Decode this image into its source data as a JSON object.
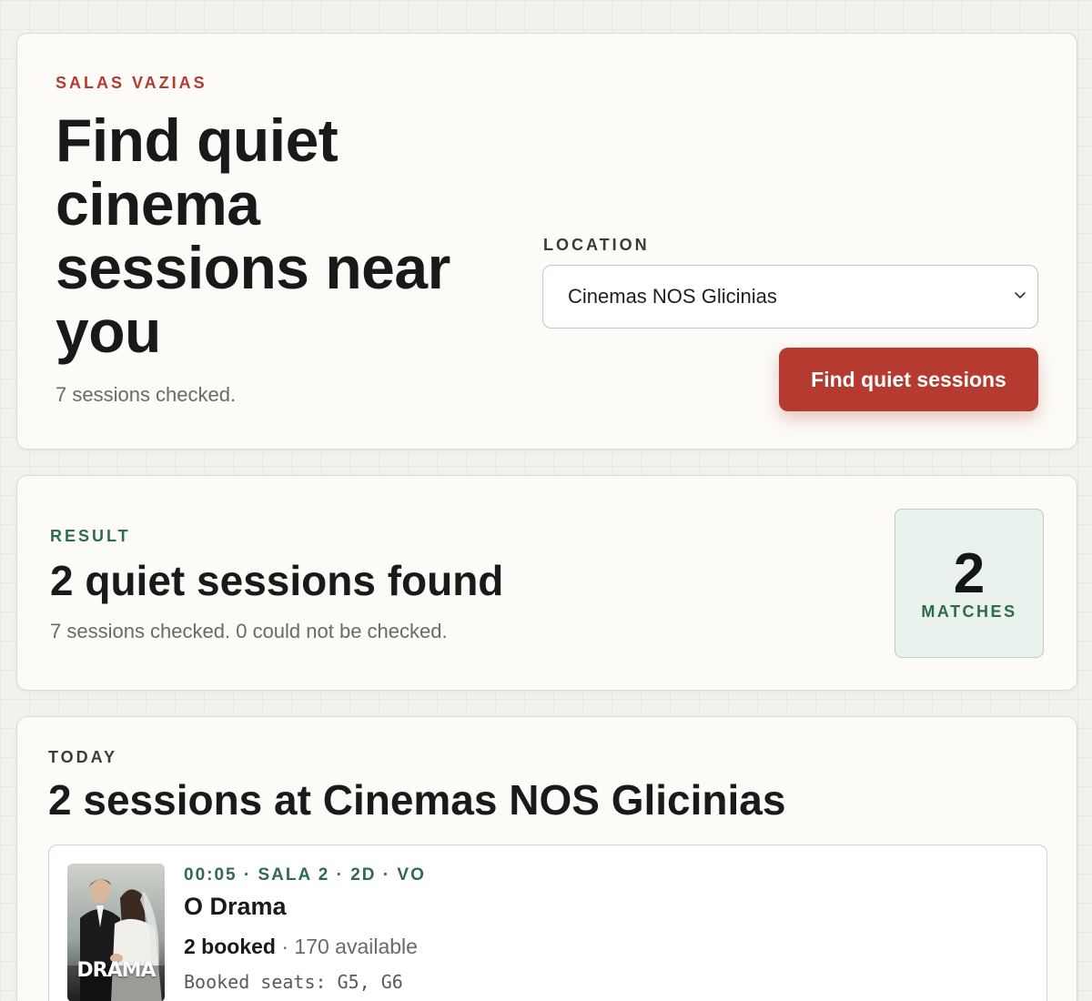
{
  "hero": {
    "eyebrow": "SALAS VAZIAS",
    "title": "Find quiet cinema sessions near you",
    "subtitle": "7 sessions checked.",
    "location_label": "LOCATION",
    "location_value": "Cinemas NOS Glicinias",
    "button_label": "Find quiet sessions"
  },
  "result": {
    "eyebrow": "RESULT",
    "title": "2 quiet sessions found",
    "subtitle": "7 sessions checked. 0 could not be checked.",
    "matches_count": "2",
    "matches_label": "MATCHES"
  },
  "today": {
    "eyebrow": "TODAY",
    "title": "2 sessions at Cinemas NOS Glicinias",
    "sessions": [
      {
        "meta": "00:05 · SALA 2 · 2D · VO",
        "title": "O Drama",
        "booked": "2 booked",
        "available": "· 170 available",
        "seats": "Booked seats: G5, G6",
        "poster_word": "DRAMA"
      }
    ]
  },
  "colors": {
    "accent": "#b53a2f",
    "success": "#2f6b4d",
    "match_bg": "#e9f2ec"
  },
  "icons": {
    "select_chevron": "chevron-down-icon"
  }
}
